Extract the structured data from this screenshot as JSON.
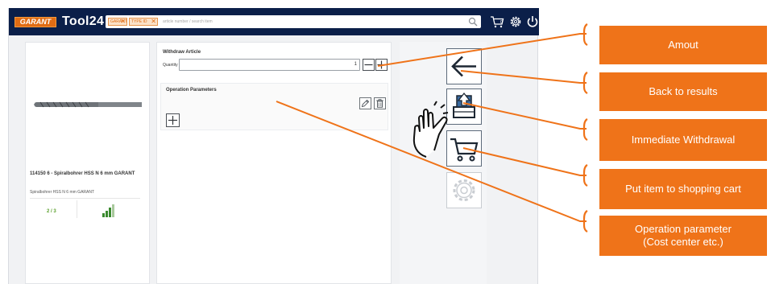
{
  "header": {
    "brand": "GARANT",
    "app_title": "Tool24",
    "search": {
      "chips": [
        "GARANT",
        "TYPE ID"
      ],
      "placeholder": "article number / search item"
    },
    "icons": [
      "search-icon",
      "shopping-cart-icon",
      "gear-icon",
      "power-icon"
    ]
  },
  "product": {
    "name": "114150 6 - Spiralbohrer HSS N 6 mm GARANT",
    "description": "Spiralbohrer HSS N 6 mm GARANT",
    "availability": "2 / 3",
    "image_icon": "twist-drill-image",
    "stock_icon": "signal-bars-icon"
  },
  "withdraw": {
    "title": "Withdraw Article",
    "quantity_label": "Quantity",
    "quantity_value": "1"
  },
  "operation": {
    "title": "Operation Parameters"
  },
  "actions": [
    "back-arrow-icon",
    "withdraw-upload-icon",
    "shopping-cart-icon",
    "settings-gear-icon"
  ],
  "callouts": {
    "amount": "Amout",
    "back": "Back to results",
    "withdraw": "Immediate Withdrawal",
    "cart": "Put item to shopping cart",
    "op_param": "Operation parameter\n(Cost center etc.)"
  },
  "colors": {
    "header_bg": "#0b1f49",
    "accent_orange": "#ef7319",
    "availability_green": "#5aa02c"
  }
}
